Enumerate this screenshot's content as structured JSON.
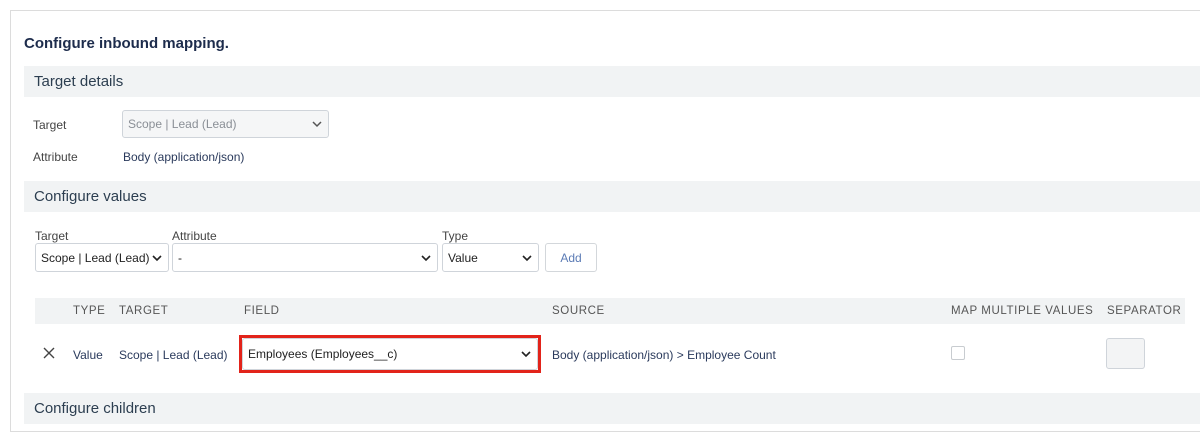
{
  "page": {
    "heading": "Configure inbound mapping."
  },
  "target_details": {
    "section_title": "Target details",
    "target_label": "Target",
    "target_value": "Scope | Lead (Lead)",
    "attribute_label": "Attribute",
    "attribute_value": "Body (application/json)"
  },
  "configure_values": {
    "section_title": "Configure values",
    "target_label": "Target",
    "target_value": "Scope | Lead (Lead)",
    "attribute_label": "Attribute",
    "attribute_value": "-",
    "type_label": "Type",
    "type_value": "Value",
    "add_label": "Add"
  },
  "table": {
    "headers": {
      "type": "TYPE",
      "target": "TARGET",
      "field": "FIELD",
      "source": "SOURCE",
      "map_multiple": "MAP MULTIPLE VALUES",
      "separator": "SEPARATOR"
    },
    "rows": [
      {
        "type": "Value",
        "target": "Scope | Lead (Lead)",
        "field": "Employees (Employees__c)",
        "source": "Body (application/json) > Employee Count",
        "map_multiple_checked": false
      }
    ]
  },
  "configure_children": {
    "section_title": "Configure children"
  },
  "colors": {
    "highlight": "#e2231a",
    "section_bg": "#f1f3f4",
    "heading": "#1d2c4c"
  }
}
